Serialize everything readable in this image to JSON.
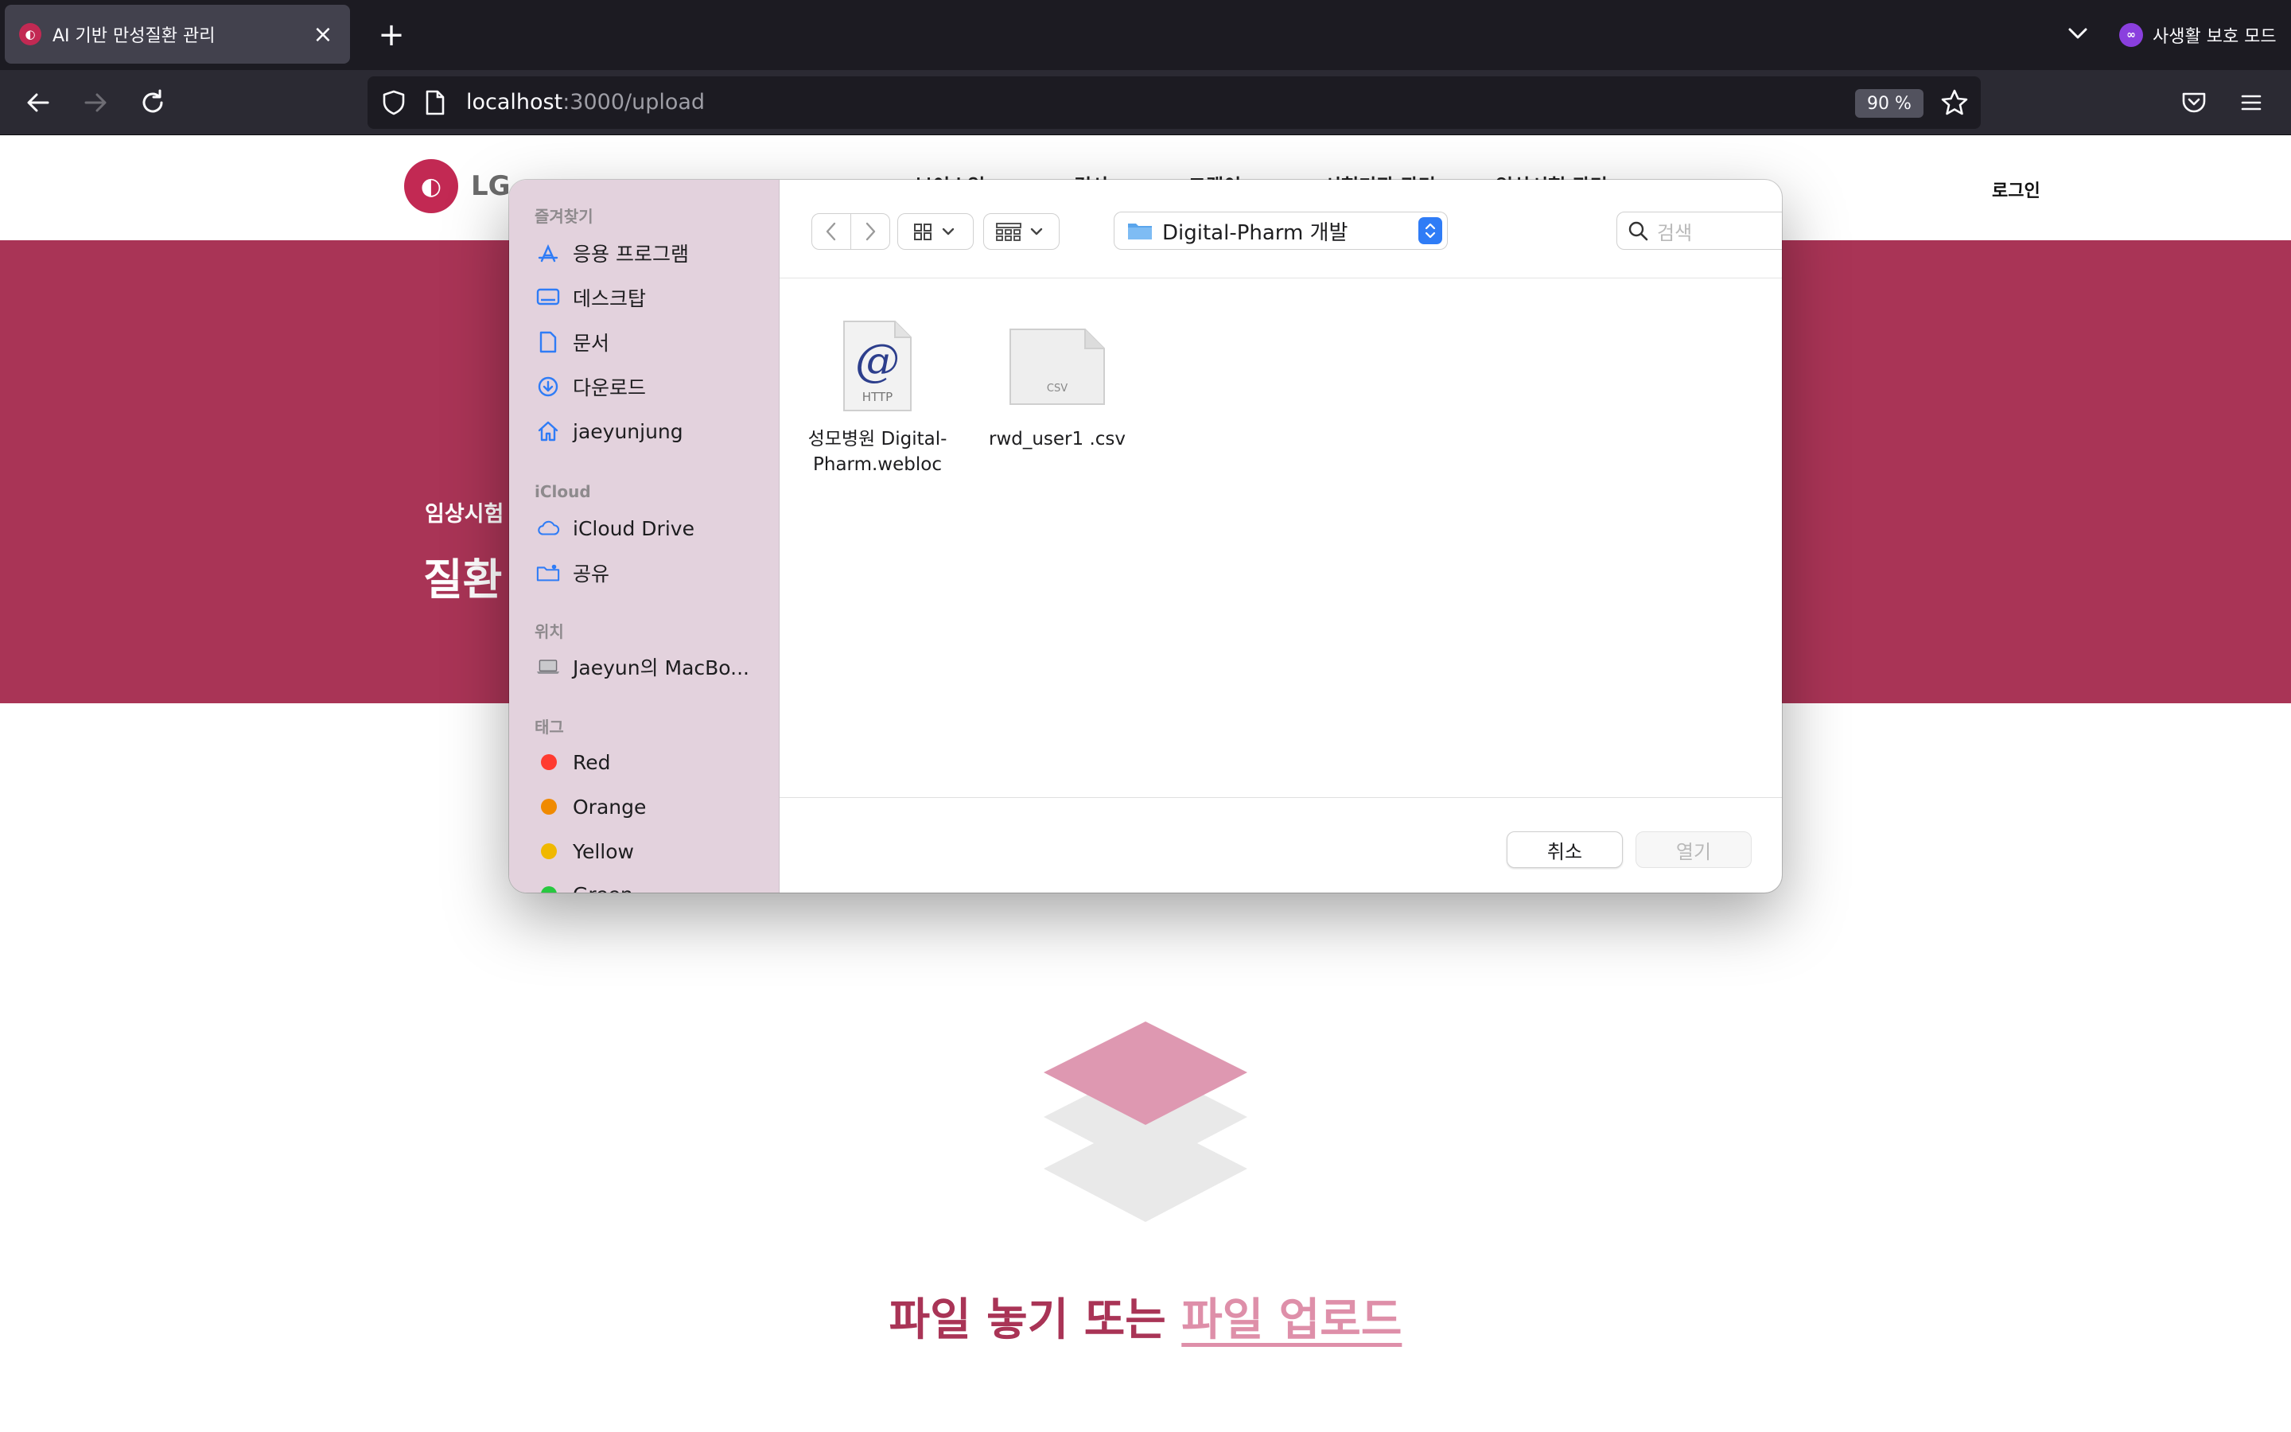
{
  "browser": {
    "tab": {
      "title": "AI 기반 만성질환 관리",
      "favicon": "lg-logo-icon"
    },
    "new_tab_label": "+",
    "private_mode_label": "사생활 보호 모드",
    "url_host": "localhost",
    "url_path": ":3000/upload",
    "zoom": "90 %"
  },
  "site": {
    "logo_text": "LG",
    "logo_partial_text": "LG",
    "nav": [
      "보이스업",
      "검사",
      "그램이",
      "시험기관 관리",
      "임상시험 관리"
    ],
    "login_label": "로그인",
    "hero_sub": "임상시험",
    "hero_title": "질환",
    "drop_text": "파일 놓기 또는 ",
    "drop_link": "파일 업로드"
  },
  "dialog": {
    "sidebar": {
      "favorites_title": "즐겨찾기",
      "favorites": [
        {
          "label": "응용 프로그램",
          "icon": "applications-icon"
        },
        {
          "label": "데스크탑",
          "icon": "desktop-icon"
        },
        {
          "label": "문서",
          "icon": "document-icon"
        },
        {
          "label": "다운로드",
          "icon": "download-icon"
        },
        {
          "label": "jaeyunjung",
          "icon": "home-icon"
        }
      ],
      "icloud_title": "iCloud",
      "icloud": [
        {
          "label": "iCloud Drive",
          "icon": "cloud-icon"
        },
        {
          "label": "공유",
          "icon": "shared-folder-icon"
        }
      ],
      "locations_title": "위치",
      "locations": [
        {
          "label": "Jaeyun의 MacBo...",
          "icon": "laptop-icon"
        }
      ],
      "tags_title": "태그",
      "tags": [
        {
          "label": "Red",
          "color": "#ff3b30"
        },
        {
          "label": "Orange",
          "color": "#f08a00"
        },
        {
          "label": "Yellow",
          "color": "#f0b800"
        },
        {
          "label": "Green",
          "color": "#28c840"
        }
      ]
    },
    "folder": "Digital-Pharm 개발",
    "search_placeholder": "검색",
    "files": [
      {
        "name": "성모병원 Digital-Pharm.webloc",
        "badge": "HTTP",
        "glyph": "@"
      },
      {
        "name": "rwd_user1 .csv",
        "badge": "CSV"
      }
    ],
    "cancel_label": "취소",
    "open_label": "열기"
  },
  "colors": {
    "brand": "#a93456",
    "brand_light": "#de8fa9",
    "accent_blue": "#2f7cf6"
  }
}
